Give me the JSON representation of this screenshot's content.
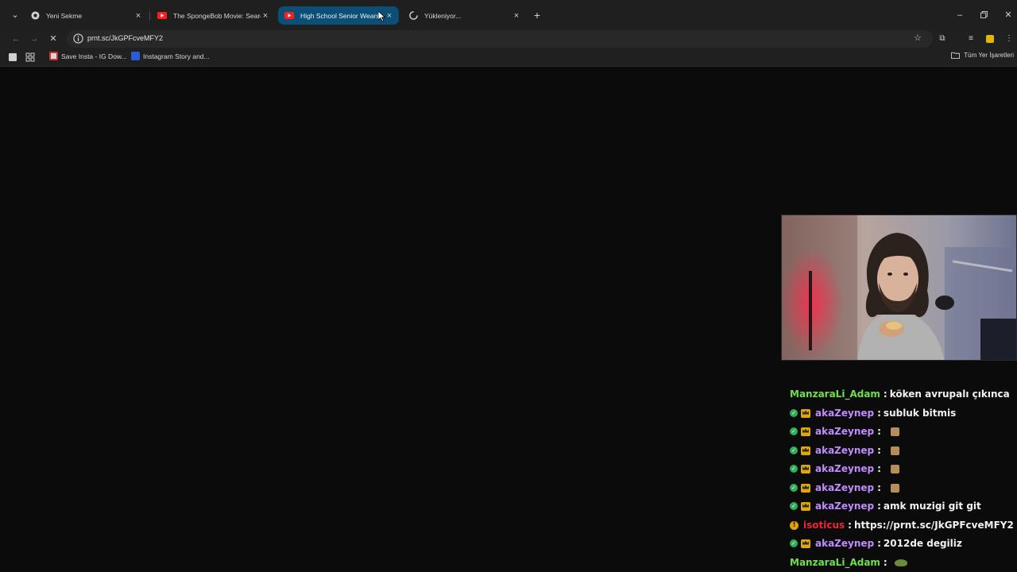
{
  "tabs": [
    {
      "title": "Yeni Sekme",
      "favicon": "chrome-icon",
      "active": false
    },
    {
      "title": "The SpongeBob Movie: Search",
      "favicon": "youtube-icon",
      "active": false
    },
    {
      "title": "High School Senior Wears",
      "favicon": "youtube-icon",
      "active": true
    },
    {
      "title": "Yükleniyor...",
      "favicon": "loading-spinner-icon",
      "active": false
    }
  ],
  "toolbar": {
    "url": "prnt.sc/JkGPFcveMFY2"
  },
  "bookmarks": {
    "items": [
      {
        "label": "Save Insta - IG Dow..."
      },
      {
        "label": "Instagram Story and..."
      }
    ],
    "all_label": "Tüm Yer İşaretleri"
  },
  "chat": {
    "messages": [
      {
        "user": "ManzaraLi_Adam",
        "text": "köken avrupalı çıkınca",
        "badges": [],
        "color": "green"
      },
      {
        "user": "akaZeynep",
        "text": "subluk bitmis",
        "badges": [
          "check",
          "crown"
        ],
        "color": "purple"
      },
      {
        "user": "akaZeynep",
        "text": "",
        "badges": [
          "check",
          "crown"
        ],
        "color": "purple",
        "emote": "emote"
      },
      {
        "user": "akaZeynep",
        "text": "",
        "badges": [
          "check",
          "crown"
        ],
        "color": "purple",
        "emote": "emote"
      },
      {
        "user": "akaZeynep",
        "text": "",
        "badges": [
          "check",
          "crown"
        ],
        "color": "purple",
        "emote": "emote"
      },
      {
        "user": "akaZeynep",
        "text": "",
        "badges": [
          "check",
          "crown"
        ],
        "color": "purple",
        "emote": "emote"
      },
      {
        "user": "akaZeynep",
        "text": "amk muzigi git git",
        "badges": [
          "check",
          "crown"
        ],
        "color": "purple"
      },
      {
        "user": "isoticus",
        "text": "https://prnt.sc/JkGPFcveMFY2",
        "badges": [
          "warn"
        ],
        "color": "red"
      },
      {
        "user": "akaZeynep",
        "text": "2012de degiliz",
        "badges": [
          "check",
          "crown"
        ],
        "color": "purple"
      },
      {
        "user": "ManzaraLi_Adam",
        "text": "",
        "badges": [],
        "color": "green",
        "emote": "frog"
      }
    ]
  },
  "colors": {
    "active_tab": "#0b4f77",
    "chat_green": "#6ee04b",
    "chat_purple": "#c08bff",
    "chat_red": "#f0233a"
  }
}
